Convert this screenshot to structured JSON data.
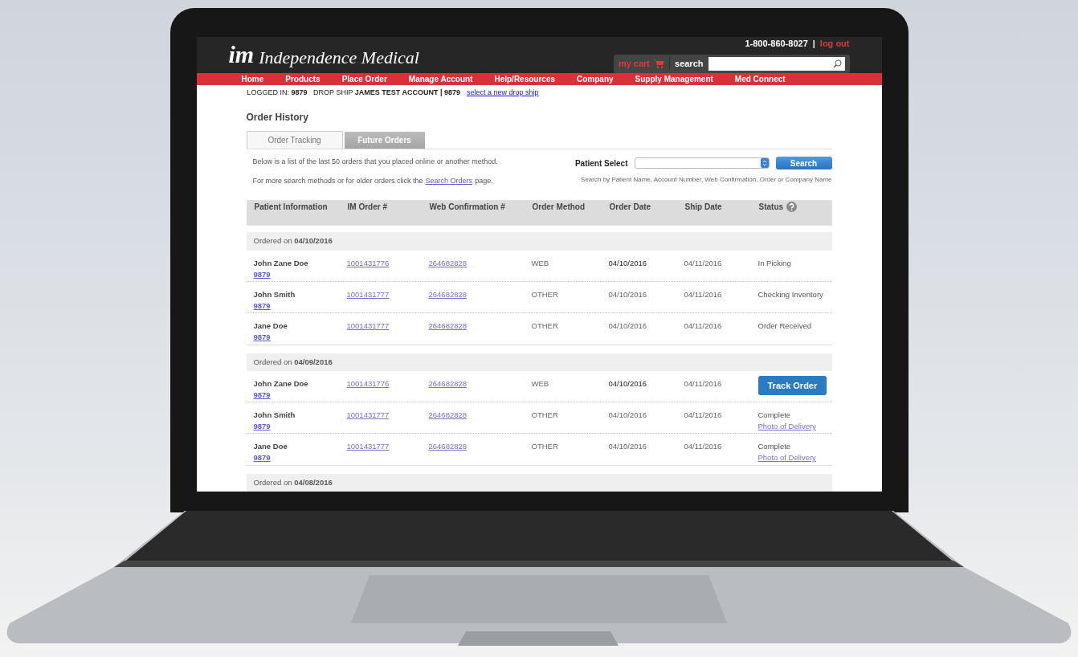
{
  "header": {
    "phone": "1-800-860-8027",
    "separator": "|",
    "logout": "log out",
    "cart": "my cart",
    "search_label": "search",
    "brand": "Independence Medical",
    "brand_mark": "im"
  },
  "nav": [
    "Home",
    "Products",
    "Place Order",
    "Manage Account",
    "Help/Resources",
    "Company",
    "Supply Management",
    "Med Connect"
  ],
  "account_bar": {
    "text": "LOGGED IN: **9879**   DROP SHIP **JAMES TEST ACCOUNT | 9879**",
    "link": "select a new drop ship"
  },
  "title": "Order History",
  "tabs": [
    {
      "label": "Order Tracking",
      "selected": true
    },
    {
      "label": "Future Orders",
      "selected": false
    }
  ],
  "intro": {
    "line1": "Below is a list of the last 50 orders that you placed online or another method.",
    "line2_before": "For more search methods or for older orders click the",
    "line2_link": "Search Orders",
    "line2_after": "page."
  },
  "patient_select": {
    "label": "Patient Select",
    "button": "Search",
    "hint": "Search by Patient Name, Account Number, Web Confirmation, Order or Company Name"
  },
  "table": {
    "columns": [
      "Patient Information",
      "IM Order #",
      "Web Confirmation #",
      "Order Method",
      "Order Date",
      "Ship Date",
      "Status"
    ],
    "groups": [
      {
        "heading": "Ordered on **04/10/2016**",
        "rows": [
          {
            "name": "John Zane Doe",
            "account": "9879",
            "im_order": "1001431776",
            "web_conf": "264682828",
            "method": "WEB",
            "order_date": "04/10/2016",
            "ship_date": "04/11/2016",
            "status": {
              "kind": "text",
              "text": "In Picking"
            }
          },
          {
            "name": "John Smith",
            "account": "9879",
            "im_order": "1001431777",
            "web_conf": "264682828",
            "method": "OTHER",
            "order_date": "04/10/2016",
            "ship_date": "04/11/2016",
            "status": {
              "kind": "text",
              "text": "Checking Inventory"
            }
          },
          {
            "name": "Jane Doe",
            "account": "9879",
            "im_order": "1001431777",
            "web_conf": "264682828",
            "method": "OTHER",
            "order_date": "04/10/2016",
            "ship_date": "04/11/2016",
            "status": {
              "kind": "text",
              "text": "Order Received"
            }
          }
        ]
      },
      {
        "heading": "Ordered on **04/09/2016**",
        "rows": [
          {
            "name": "John Zane Doe",
            "account": "9879",
            "im_order": "1001431776",
            "web_conf": "264682828",
            "method": "WEB",
            "order_date": "04/10/2016",
            "ship_date": "04/11/2016",
            "status": {
              "kind": "button",
              "text": "Track Order"
            }
          },
          {
            "name": "John Smith",
            "account": "9879",
            "im_order": "1001431777",
            "web_conf": "264682828",
            "method": "OTHER",
            "order_date": "04/10/2016",
            "ship_date": "04/11/2016",
            "status": {
              "kind": "link",
              "text": "Complete",
              "link": "Photo of Delivery"
            }
          },
          {
            "name": "Jane Doe",
            "account": "9879",
            "im_order": "1001431777",
            "web_conf": "264682828",
            "method": "OTHER",
            "order_date": "04/10/2016",
            "ship_date": "04/11/2016",
            "status": {
              "kind": "link",
              "text": "Complete",
              "link": "Photo of Delivery"
            }
          }
        ]
      },
      {
        "heading": "Ordered on **04/08/2016**"
      }
    ]
  }
}
